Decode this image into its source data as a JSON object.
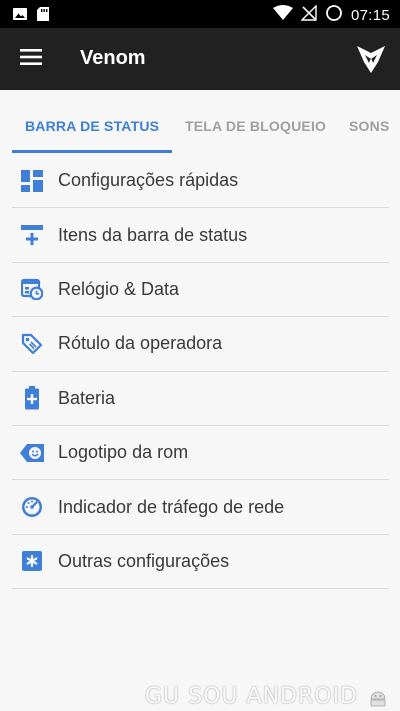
{
  "status_bar": {
    "time": "07:15",
    "icons": [
      "image-notification-icon",
      "sd-card-icon",
      "wifi-icon",
      "no-signal-icon",
      "alarm-ring-icon"
    ]
  },
  "toolbar": {
    "title": "Venom",
    "menu_icon": "hamburger-menu-icon",
    "logo_icon": "venom-fang-logo-icon"
  },
  "tabs": [
    {
      "label": "BARRA DE STATUS",
      "active": true
    },
    {
      "label": "TELA DE BLOQUEIO",
      "active": false
    },
    {
      "label": "SONS",
      "active": false
    }
  ],
  "accent_color": "#3f7fd8",
  "menu_items": [
    {
      "label": "Configurações rápidas",
      "icon": "dashboard-icon"
    },
    {
      "label": "Itens da barra de status",
      "icon": "status-bar-add-icon"
    },
    {
      "label": "Relógio & Data",
      "icon": "calendar-clock-icon"
    },
    {
      "label": "Rótulo da operadora",
      "icon": "tag-icon"
    },
    {
      "label": "Bateria",
      "icon": "battery-plus-icon"
    },
    {
      "label": "Logotipo da rom",
      "icon": "smiley-tag-icon"
    },
    {
      "label": "Indicador de tráfego de rede",
      "icon": "speedometer-icon"
    },
    {
      "label": "Outras configurações",
      "icon": "asterisk-box-icon"
    }
  ],
  "watermark": {
    "text": "GU SOU ANDROID"
  }
}
